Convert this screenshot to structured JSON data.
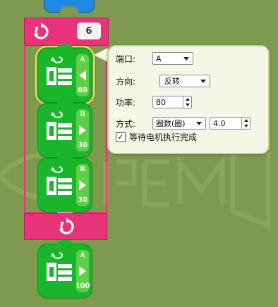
{
  "loop": {
    "count": "6",
    "icon": "loop-repeat-icon"
  },
  "blocks": [
    {
      "port": "A",
      "direction": "left",
      "power": "80"
    },
    {
      "port": "B",
      "direction": "right",
      "power": "30"
    },
    {
      "port": "B",
      "direction": "right",
      "power": "30"
    },
    {
      "port": "A",
      "direction": "right",
      "power": "100"
    }
  ],
  "popup": {
    "port_label": "端口:",
    "port_value": "A",
    "direction_label": "方向:",
    "direction_value": "反转",
    "power_label": "功率:",
    "power_value": "80",
    "mode_label": "方式:",
    "mode_value": "圈数(圈)",
    "mode_amount": "4.0",
    "wait_label": "等待电机执行完成",
    "wait_checked": "✓"
  },
  "colors": {
    "background": "#7d9a4e",
    "motor_green": "#19b52a",
    "loop_pink": "#e8327a",
    "top_block_blue": "#1e88e5",
    "selection_yellow": "#f0e64a"
  }
}
